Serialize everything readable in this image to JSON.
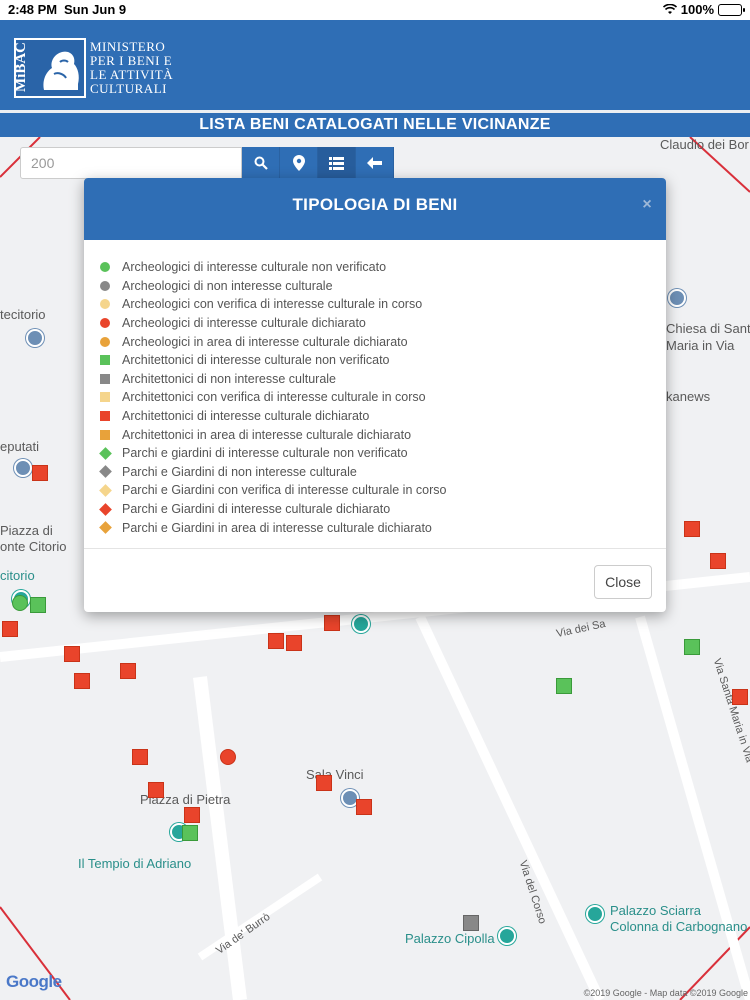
{
  "status_bar": {
    "time": "2:48 PM",
    "date": "Sun Jun 9",
    "battery": "100%",
    "battery_level": 1.0
  },
  "header": {
    "logo_text": "MiBAC",
    "ministry_lines": [
      "MINISTERO",
      "PER I BENI E",
      "LE ATTIVITÀ",
      "CULTURALI"
    ],
    "page_title": "LISTA BENI CATALOGATI NELLE VICINANZE"
  },
  "search": {
    "value": "200"
  },
  "toolbar": {
    "buttons": [
      "search-icon",
      "location-pin-icon",
      "list-icon",
      "arrow-left-icon"
    ],
    "active": "list-icon"
  },
  "colors": {
    "primary": "#2f6eb5",
    "green": "#5ac25a",
    "grey": "#888888",
    "yellow": "#f5d58c",
    "red": "#e9442b",
    "orange": "#e8a23a"
  },
  "modal": {
    "title": "TIPOLOGIA DI BENI",
    "close_x": "×",
    "close_label": "Close",
    "legend": [
      {
        "shape": "circle",
        "color": "#5ac25a",
        "label": "Archeologici di interesse culturale non verificato"
      },
      {
        "shape": "circle",
        "color": "#888888",
        "label": "Archeologici di non interesse culturale"
      },
      {
        "shape": "circle",
        "color": "#f5d58c",
        "label": "Archeologici con verifica di interesse culturale in corso"
      },
      {
        "shape": "circle",
        "color": "#e9442b",
        "label": "Archeologici di interesse culturale dichiarato"
      },
      {
        "shape": "circle",
        "color": "#e8a23a",
        "label": "Archeologici in area di interesse culturale dichiarato"
      },
      {
        "shape": "square",
        "color": "#5ac25a",
        "label": "Architettonici di interesse culturale non verificato"
      },
      {
        "shape": "square",
        "color": "#888888",
        "label": "Architettonici di non interesse culturale"
      },
      {
        "shape": "square",
        "color": "#f5d58c",
        "label": "Architettonici con verifica di interesse culturale in corso"
      },
      {
        "shape": "square",
        "color": "#e9442b",
        "label": "Architettonici di interesse culturale dichiarato"
      },
      {
        "shape": "square",
        "color": "#e8a23a",
        "label": "Architettonici in area di interesse culturale dichiarato"
      },
      {
        "shape": "diamond",
        "color": "#5ac25a",
        "label": "Parchi e giardini di interesse culturale non verificato"
      },
      {
        "shape": "diamond",
        "color": "#888888",
        "label": "Parchi e Giardini di non interesse culturale"
      },
      {
        "shape": "diamond",
        "color": "#f5d58c",
        "label": "Parchi e Giardini con verifica di interesse culturale in corso"
      },
      {
        "shape": "diamond",
        "color": "#e9442b",
        "label": "Parchi e Giardini di interesse culturale dichiarato"
      },
      {
        "shape": "diamond",
        "color": "#e8a23a",
        "label": "Parchi e Giardini in area di interesse culturale dichiarato"
      }
    ]
  },
  "map": {
    "labels": {
      "claudio": "Claudio dei Bor",
      "piazza_di": "Piazza di",
      "tecitorio": "tecitorio",
      "chiesa_1": "Chiesa di Sant",
      "chiesa_2": "Maria in Via",
      "kanews": "kanews",
      "eputati": "eputati",
      "piazza_di_2": "Piazza di",
      "monte_citorio": "onte Citorio",
      "citorio": "citorio",
      "via_dei_sa": "Via dei Sa",
      "via_santa_maria": "Via Santa Maria in Via",
      "sala_vinci": "Sala Vinci",
      "piazza_di_pietra": "Piazza di Pietra",
      "tempio": "Il Tempio di Adriano",
      "via_del_corso": "Via del Corso",
      "via_de_burro": "Via de' Burrò",
      "palazzo_sciarra_1": "Palazzo Sciarra",
      "palazzo_sciarra_2": "Colonna di Carbognano",
      "palazzo_cipolla": "Palazzo Cipolla",
      "google": "Google",
      "copyright": "©2019 Google - Map data ©2019 Google"
    }
  }
}
